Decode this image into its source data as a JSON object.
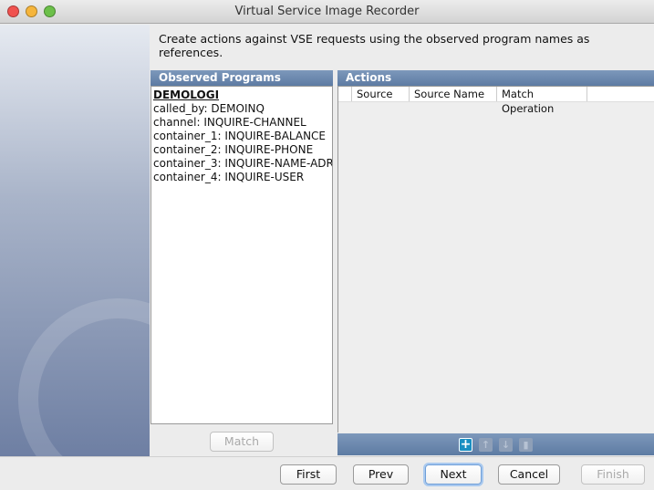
{
  "window": {
    "title": "Virtual Service Image Recorder"
  },
  "intro": "Create actions against VSE requests using the observed program names as references.",
  "observed": {
    "header": "Observed Programs",
    "items": [
      "DEMOLOGI",
      "called_by: DEMOINQ",
      "channel: INQUIRE-CHANNEL",
      "container_1: INQUIRE-BALANCE",
      "container_2: INQUIRE-PHONE",
      "container_3: INQUIRE-NAME-ADR",
      "container_4: INQUIRE-USER"
    ],
    "match_label": "Match"
  },
  "actions": {
    "header": "Actions",
    "columns": [
      "Source",
      "Source Name",
      "Match Operation"
    ],
    "toolbar": [
      {
        "icon": "add-icon",
        "enabled": true
      },
      {
        "icon": "arrow-up-icon",
        "enabled": false
      },
      {
        "icon": "arrow-down-icon",
        "enabled": false
      },
      {
        "icon": "trash-icon",
        "enabled": false
      }
    ]
  },
  "buttons": {
    "first": "First",
    "prev": "Prev",
    "next": "Next",
    "cancel": "Cancel",
    "finish": "Finish"
  }
}
